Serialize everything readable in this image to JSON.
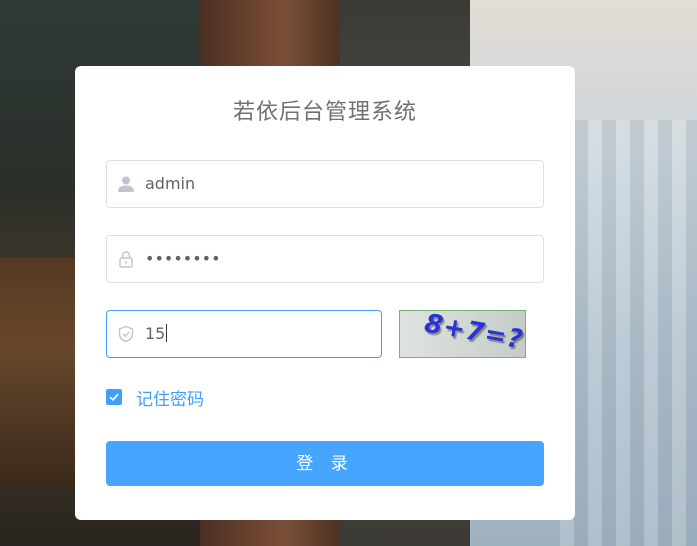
{
  "title": "若依后台管理系统",
  "form": {
    "username": {
      "value": "admin",
      "icon": "user-icon"
    },
    "password": {
      "value": "••••••••",
      "icon": "lock-icon"
    },
    "code": {
      "value": "15",
      "icon": "shield-icon"
    },
    "captcha_text": "8+7=?",
    "remember_label": "记住密码",
    "remember_checked": true,
    "login_label": "登 录"
  },
  "colors": {
    "accent": "#409eff",
    "button": "#46a6ff",
    "captcha_text": "#2b33d8"
  }
}
